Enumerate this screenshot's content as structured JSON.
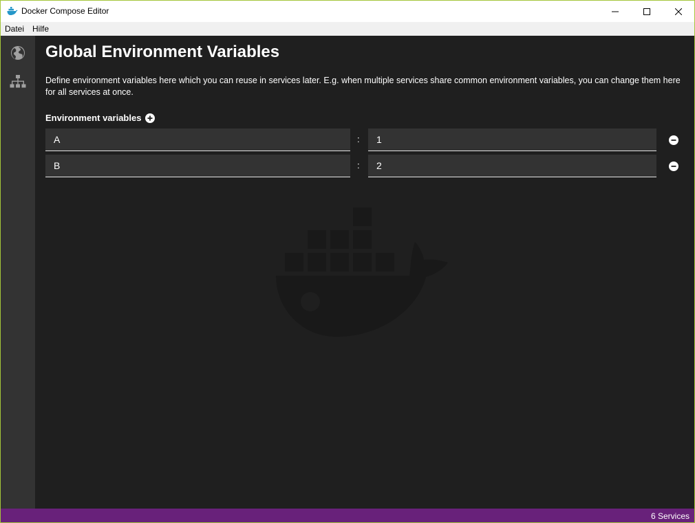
{
  "window": {
    "title": "Docker Compose Editor",
    "icon": "docker-whale-icon"
  },
  "menu": {
    "items": [
      "Datei",
      "Hilfe"
    ]
  },
  "sidebar": {
    "items": [
      {
        "icon": "globe-icon",
        "active": true
      },
      {
        "icon": "network-icon",
        "active": false
      }
    ]
  },
  "main": {
    "title": "Global Environment Variables",
    "description": "Define environment variables here which you can reuse in services later. E.g. when multiple services share common environment variables, you can change them here for all services at once.",
    "section_label": "Environment variables",
    "separator": ":",
    "variables": [
      {
        "key": "A",
        "value": "1"
      },
      {
        "key": "B",
        "value": "2"
      }
    ]
  },
  "status": {
    "text": "6 Services"
  },
  "colors": {
    "accent": "#68217a",
    "background": "#1f1f1f",
    "sidebar": "#333333",
    "input_bg": "#333333"
  }
}
